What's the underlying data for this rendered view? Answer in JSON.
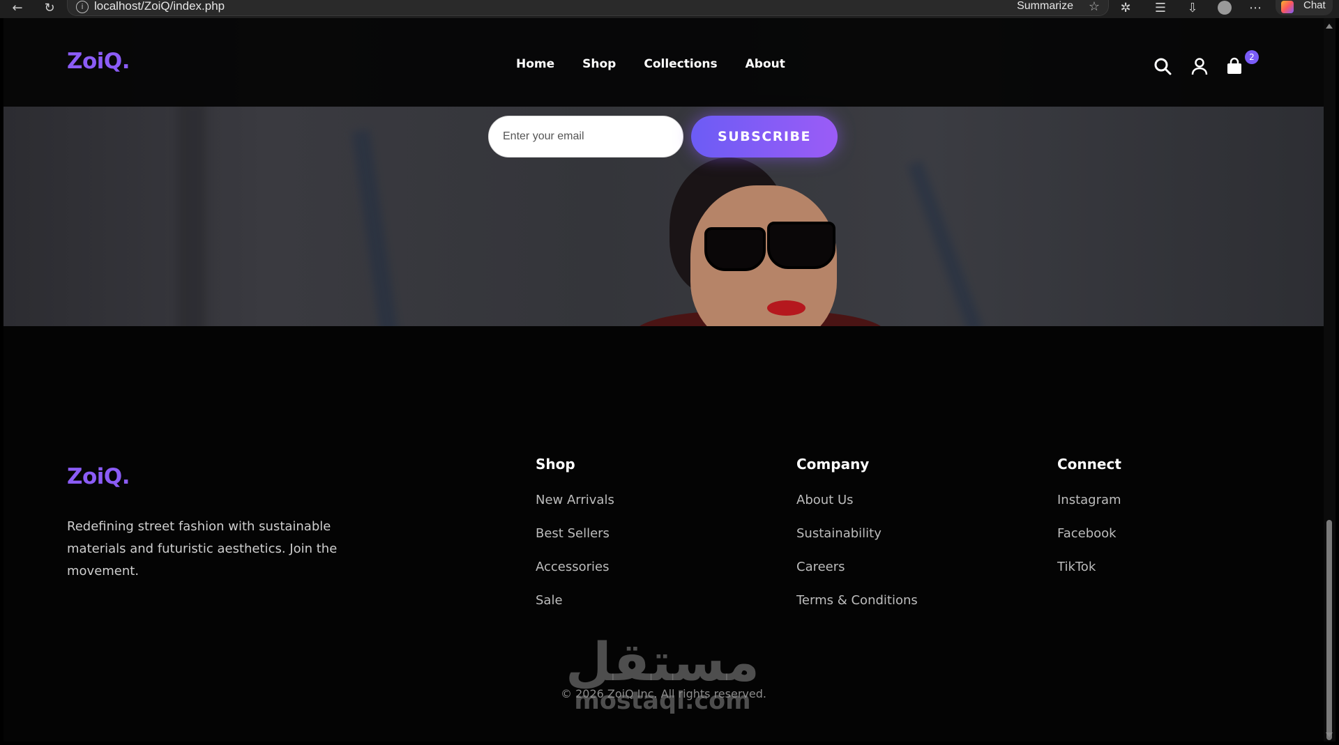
{
  "browser": {
    "url": "localhost/ZoiQ/index.php",
    "summarize_label": "Summarize",
    "chat_label": "Chat"
  },
  "brand": {
    "name": "ZoiQ.",
    "color": "#8b5cf6"
  },
  "header": {
    "nav": [
      "Home",
      "Shop",
      "Collections",
      "About"
    ],
    "cart_count": "2"
  },
  "newsletter": {
    "placeholder": "Enter your email",
    "button_label": "SUBSCRIBE"
  },
  "footer": {
    "tagline": "Redefining street fashion with sustainable materials and futuristic aesthetics. Join the movement.",
    "columns": [
      {
        "title": "Shop",
        "links": [
          "New Arrivals",
          "Best Sellers",
          "Accessories",
          "Sale"
        ]
      },
      {
        "title": "Company",
        "links": [
          "About Us",
          "Sustainability",
          "Careers",
          "Terms & Conditions"
        ]
      },
      {
        "title": "Connect",
        "links": [
          "Instagram",
          "Facebook",
          "TikTok"
        ]
      }
    ],
    "copyright": "© 2026 ZoiQ Inc. All rights reserved."
  },
  "watermark": {
    "arabic": "مستقل",
    "latin": "mostaql.com"
  }
}
